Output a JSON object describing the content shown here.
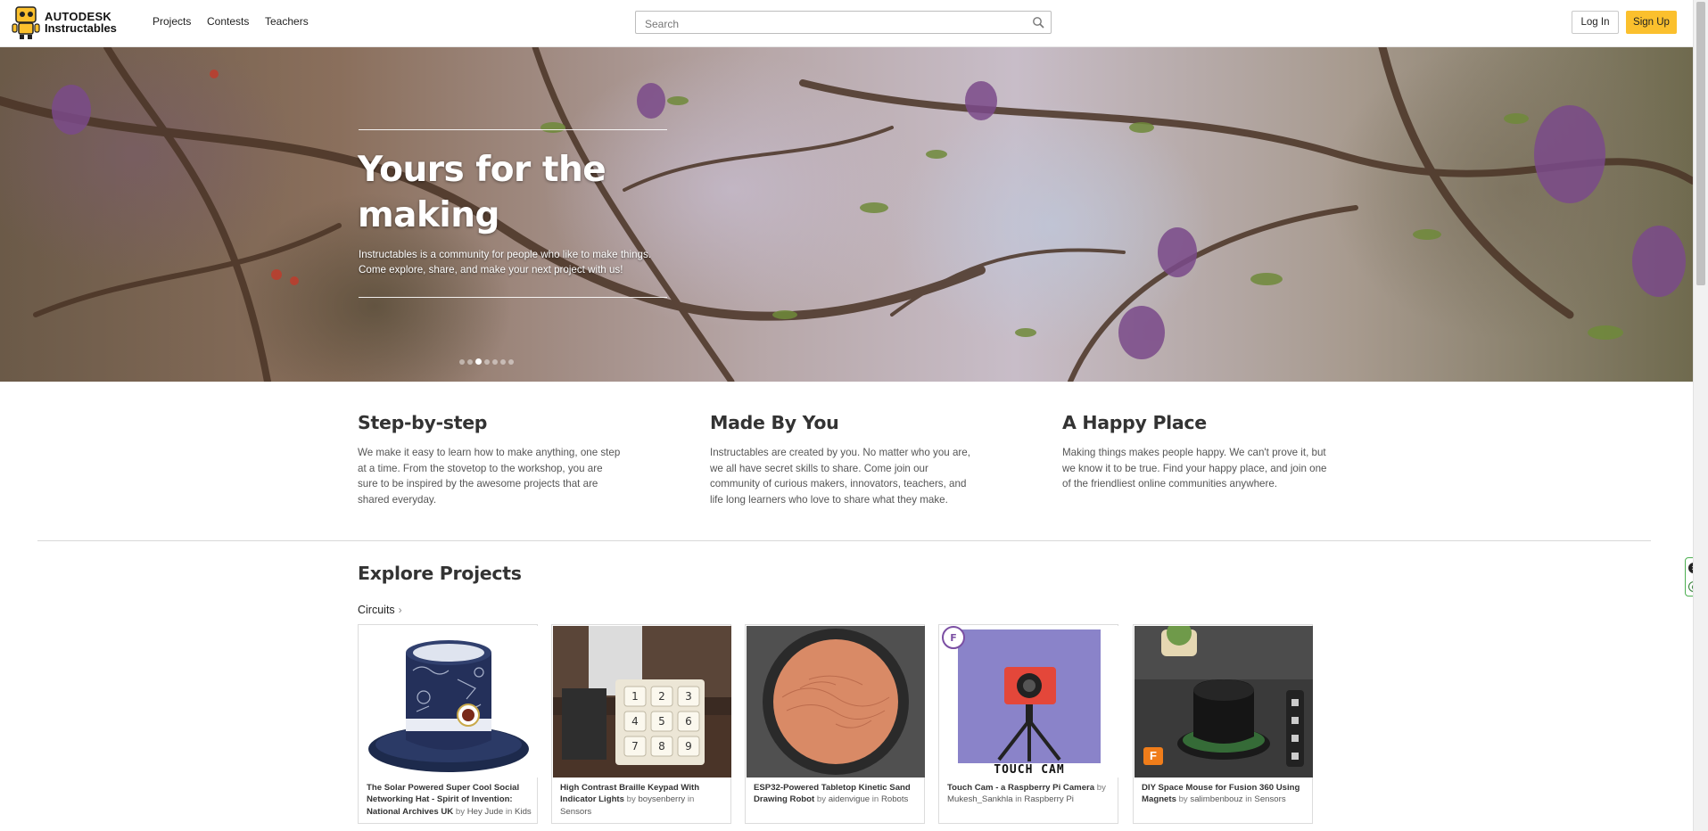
{
  "brand": {
    "line1": "AUTODESK",
    "line2": "Instructables"
  },
  "nav": {
    "projects": "Projects",
    "contests": "Contests",
    "teachers": "Teachers"
  },
  "search": {
    "placeholder": "Search",
    "value": ""
  },
  "auth": {
    "login": "Log In",
    "signup": "Sign Up"
  },
  "hero": {
    "title": "Yours for the making",
    "subtitle": "Instructables is a community for people who like to make things. Come explore, share, and make your next project with us!",
    "slides": 7,
    "active_slide": 3
  },
  "features": [
    {
      "title": "Step-by-step",
      "text": "We make it easy to learn how to make anything, one step at a time. From the stovetop to the workshop, you are sure to be inspired by the awesome projects that are shared everyday."
    },
    {
      "title": "Made By You",
      "text": "Instructables are created by you. No matter who you are, we all have secret skills to share. Come join our community of curious makers, innovators, teachers, and life long learners who love to share what they make."
    },
    {
      "title": "A Happy Place",
      "text": "Making things makes people happy. We can't prove it, but we know it to be true. Find your happy place, and join one of the friendliest online communities anywhere."
    }
  ],
  "explore": {
    "title": "Explore Projects",
    "category": "Circuits",
    "cards": [
      {
        "title": "The Solar Powered Super Cool Social Networking Hat - Spirit of Invention: National Archives UK",
        "by": "by",
        "author": "Hey Jude",
        "in": "in",
        "category": "Kids"
      },
      {
        "title": "High Contrast Braille Keypad With Indicator Lights",
        "by": "by",
        "author": "boysenberry",
        "in": "in",
        "category": "Sensors"
      },
      {
        "title": "ESP32-Powered Tabletop Kinetic Sand Drawing Robot",
        "by": "by",
        "author": "aidenvigue",
        "in": "in",
        "category": "Robots"
      },
      {
        "title": "Touch Cam - a Raspberry Pi Camera",
        "by": "by",
        "author": "Mukesh_Sankhla",
        "in": "in",
        "category": "Raspberry Pi"
      },
      {
        "title": "DIY Space Mouse for Fusion 360 Using Magnets",
        "by": "by",
        "author": "salimbenbouz",
        "in": "in",
        "category": "Sensors"
      }
    ],
    "touch_cam_label": "TOUCH CAM",
    "fusion_badge": "F",
    "keypad_keys": [
      "1",
      "2",
      "3",
      "4",
      "5",
      "6",
      "7",
      "8",
      "9"
    ]
  },
  "colors": {
    "accent": "#fbc02d",
    "text": "#333333",
    "muted": "#555555"
  }
}
